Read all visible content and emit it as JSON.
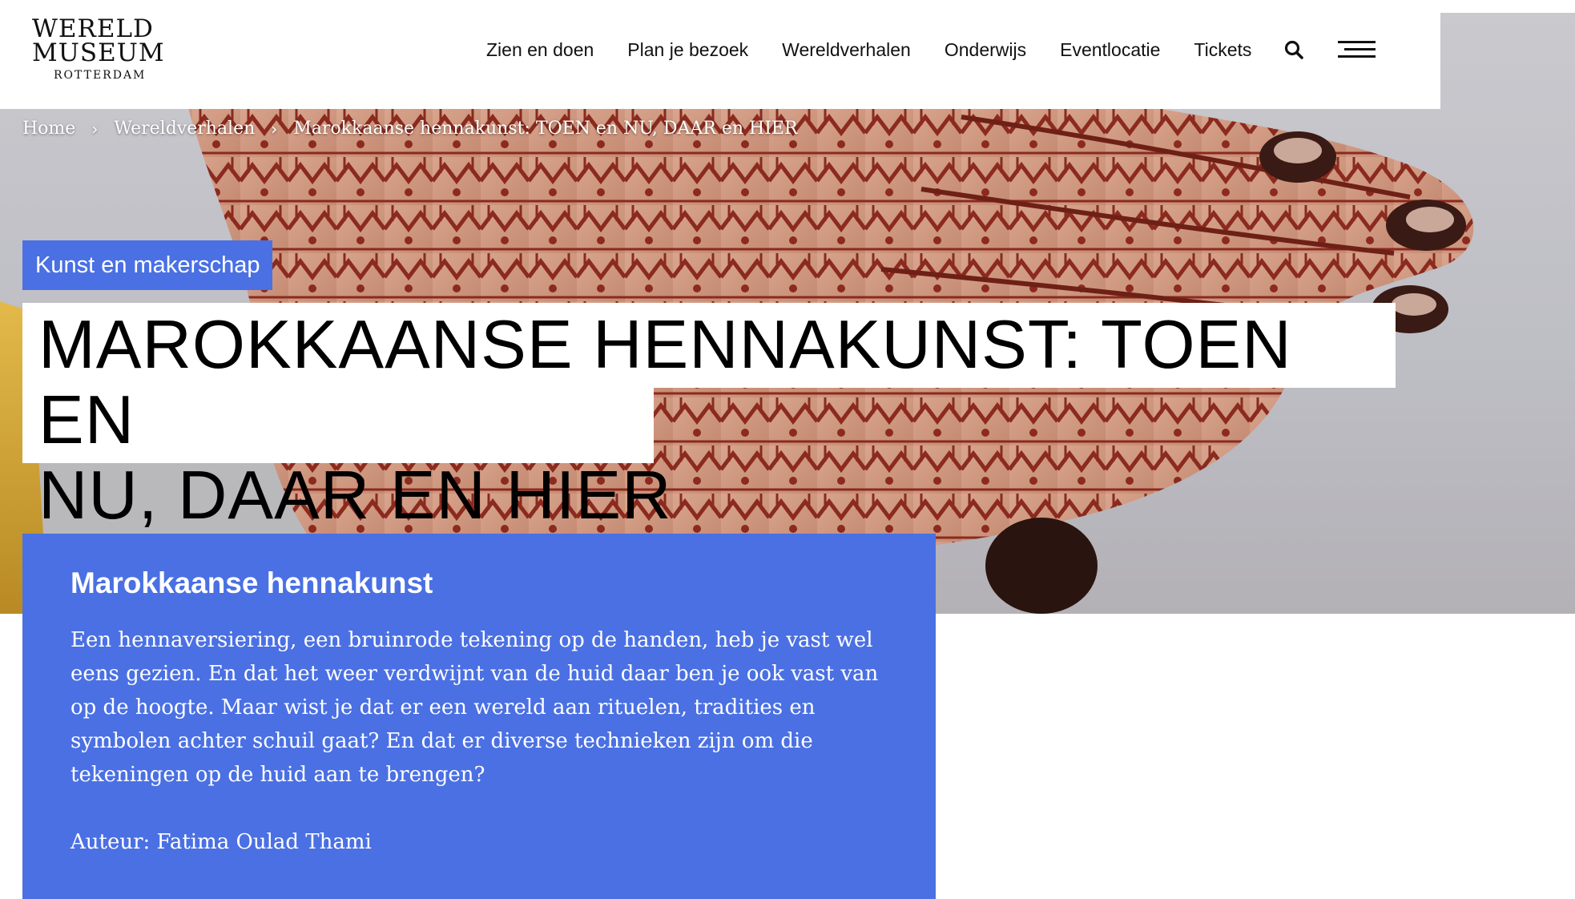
{
  "logo": {
    "line1": "WERELD",
    "line2": "MUSEUM",
    "line3": "ROTTERDAM"
  },
  "nav": {
    "items": [
      "Zien en doen",
      "Plan je bezoek",
      "Wereldverhalen",
      "Onderwijs",
      "Eventlocatie",
      "Tickets"
    ],
    "search_icon": "search-icon",
    "menu_icon": "hamburger-menu-icon"
  },
  "breadcrumb": {
    "items": [
      "Home",
      "Wereldverhalen",
      "Marokkaanse hennakunst: TOEN en NU, DAAR en HIER"
    ],
    "separator_icon": "chevron-right-icon"
  },
  "category": "Kunst en makerschap",
  "title": {
    "line1": "MAROKKAANSE HENNAKUNST: TOEN EN",
    "line2": "NU, DAAR EN HIER"
  },
  "intro": {
    "heading": "Marokkaanse hennakunst",
    "body": "Een hennaversiering, een bruinrode tekening op de handen, heb je vast wel eens gezien. En dat het weer verdwijnt van de huid daar ben je ook vast van op de hoogte. Maar wist je dat er een wereld aan rituelen, tradities en symbolen achter schuil gaat?  En dat er diverse technieken zijn om die tekeningen op de huid aan te brengen?",
    "author": "Auteur: Fatima Oulad Thami"
  },
  "colors": {
    "accent": "#4a70e3",
    "henna": "#8b2a1e",
    "text": "#111111"
  }
}
